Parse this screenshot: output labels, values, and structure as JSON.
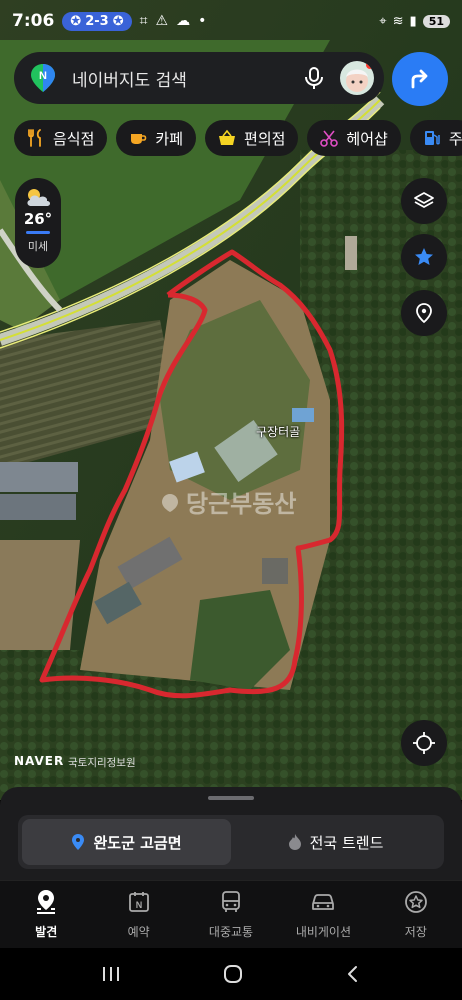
{
  "status": {
    "time": "7:06",
    "score_pill": "2-3",
    "battery": "51"
  },
  "search": {
    "placeholder": "네이버지도 검색"
  },
  "chips": [
    {
      "label": "음식점",
      "icon": "fork-knife-icon",
      "color": "#f5a623"
    },
    {
      "label": "카페",
      "icon": "coffee-cup-icon",
      "color": "#f5a623"
    },
    {
      "label": "편의점",
      "icon": "basket-icon",
      "color": "#f5d423"
    },
    {
      "label": "헤어샵",
      "icon": "scissors-icon",
      "color": "#e04ec5"
    },
    {
      "label": "주",
      "icon": "fuel-icon",
      "color": "#3a8bf5"
    }
  ],
  "weather": {
    "temp": "26°",
    "air": "미세"
  },
  "map": {
    "place_label": "구장터골",
    "watermark": "당근부동산",
    "brand": "NAVER",
    "credit": "국토지리정보원",
    "boundary_color": "#d8282f"
  },
  "sheet": {
    "tab_region": "완도군 고금면",
    "tab_trend": "전국 트렌드"
  },
  "navbar": [
    {
      "label": "발견",
      "icon": "discover-pin-icon",
      "active": true
    },
    {
      "label": "예약",
      "icon": "calendar-n-icon",
      "active": false
    },
    {
      "label": "대중교통",
      "icon": "bus-icon",
      "active": false
    },
    {
      "label": "내비게이션",
      "icon": "car-icon",
      "active": false
    },
    {
      "label": "저장",
      "icon": "star-circle-icon",
      "active": false
    }
  ],
  "colors": {
    "accent": "#2a7cf5",
    "sheet_bg": "#1c1c1e"
  }
}
